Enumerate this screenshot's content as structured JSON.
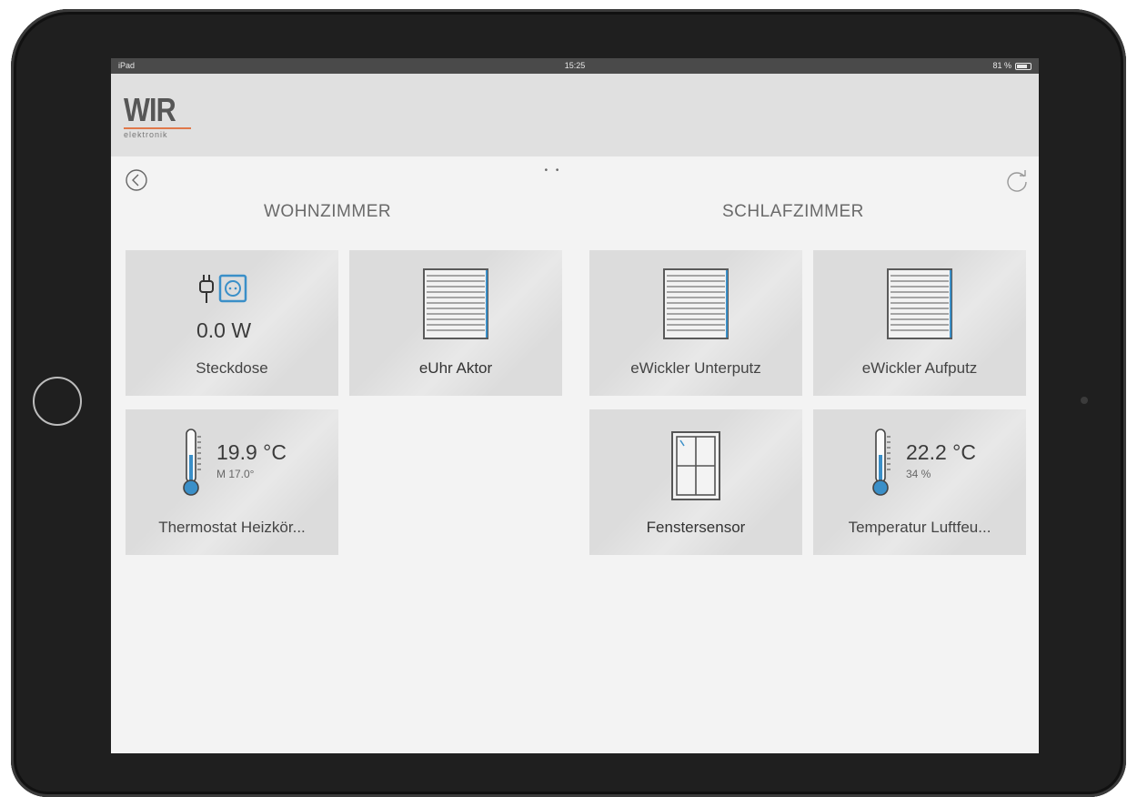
{
  "status_bar": {
    "device": "iPad",
    "time": "15:25",
    "battery": "81 %",
    "battery_level": 0.81
  },
  "header": {
    "logo_main": "WIR",
    "logo_sub": "elektronik"
  },
  "pagination": {
    "dots": "• •"
  },
  "rooms": [
    {
      "title": "WOHNZIMMER",
      "tiles": [
        {
          "label": "Steckdose",
          "value": "0.0 W",
          "icon": "plug-socket-icon"
        },
        {
          "label": "eUhr Aktor",
          "icon": "blind-icon"
        },
        {
          "label": "Thermostat Heizkör...",
          "value": "19.9 °C",
          "sub_value": "M 17.0°",
          "icon": "thermometer-icon"
        }
      ]
    },
    {
      "title": "SCHLAFZIMMER",
      "tiles": [
        {
          "label": "eWickler Unterputz",
          "icon": "blind-icon"
        },
        {
          "label": "eWickler Aufputz",
          "icon": "blind-icon"
        },
        {
          "label": "Fenstersensor",
          "icon": "window-icon"
        },
        {
          "label": "Temperatur Luftfeu...",
          "value": "22.2 °C",
          "sub_value": "34 %",
          "icon": "thermometer-icon"
        }
      ]
    }
  ],
  "colors": {
    "accent_blue": "#3a8fc8",
    "logo_line": "#e0784a",
    "tile_bg": "#dcdcdc"
  }
}
